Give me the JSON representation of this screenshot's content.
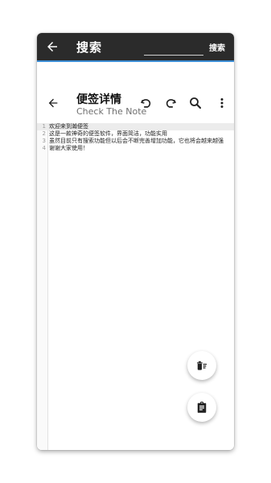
{
  "search_bar": {
    "title": "搜索",
    "query": "",
    "submit_label": "搜索"
  },
  "note_toolbar": {
    "title": "便签详情",
    "subtitle": "Check The Note",
    "icons": [
      "back-icon",
      "undo-icon",
      "redo-icon",
      "search-icon",
      "more-vert-icon"
    ]
  },
  "editor": {
    "lines": [
      {
        "num": "1",
        "text": "欢迎来到瀚便签"
      },
      {
        "num": "2",
        "text": "这是一款神奇的便签软件，界面简洁，功能实用"
      },
      {
        "num": "3",
        "text": "虽然目前只有搜索功能但以后会不断完善增加功能，它也将会越来越强"
      },
      {
        "num": "4",
        "text": "谢谢大家使用！"
      }
    ]
  },
  "fabs": {
    "icons": [
      "delete-sweep-icon",
      "clipboard-icon"
    ]
  },
  "colors": {
    "search_bar_bg": "#2b2b2b",
    "accent": "#3d8fd6"
  }
}
